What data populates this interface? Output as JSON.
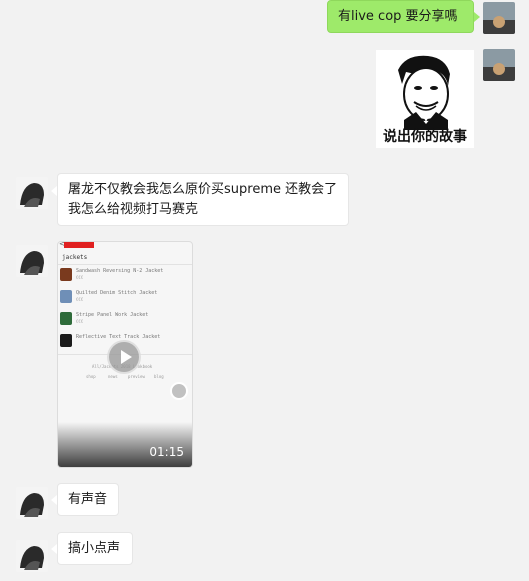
{
  "messages": {
    "m1": "有live cop 要分享嗎",
    "sticker_caption": "说出你的故事",
    "m2": "屠龙不仅教会我怎么原价买supreme 还教会了我怎么给视频打马赛克",
    "m3": "有声音",
    "m4": "搞小点声"
  },
  "video": {
    "duration": "01:15",
    "brand": "Supreme",
    "page_title": "jackets",
    "items": [
      {
        "name": "Sandwash Reversing N-2 Jacket",
        "price": "€€€",
        "color": "#7a3a1e"
      },
      {
        "name": "Quilted Denim Stitch Jacket",
        "price": "€€€",
        "color": "#6f8fb7"
      },
      {
        "name": "Stripe Panel Work Jacket",
        "price": "€€€",
        "color": "#2e6b3a"
      },
      {
        "name": "Reflective Text Track Jacket",
        "price": "€€€",
        "color": "#1b1b1b"
      }
    ],
    "footer_text": "All/Jackets 2018 Lookbook",
    "footer_links": [
      "shop",
      "news",
      "preview",
      "blog"
    ]
  },
  "colors": {
    "background": "#f2f2f2",
    "sent_bubble": "#9eea6a",
    "received_bubble": "#ffffff"
  }
}
